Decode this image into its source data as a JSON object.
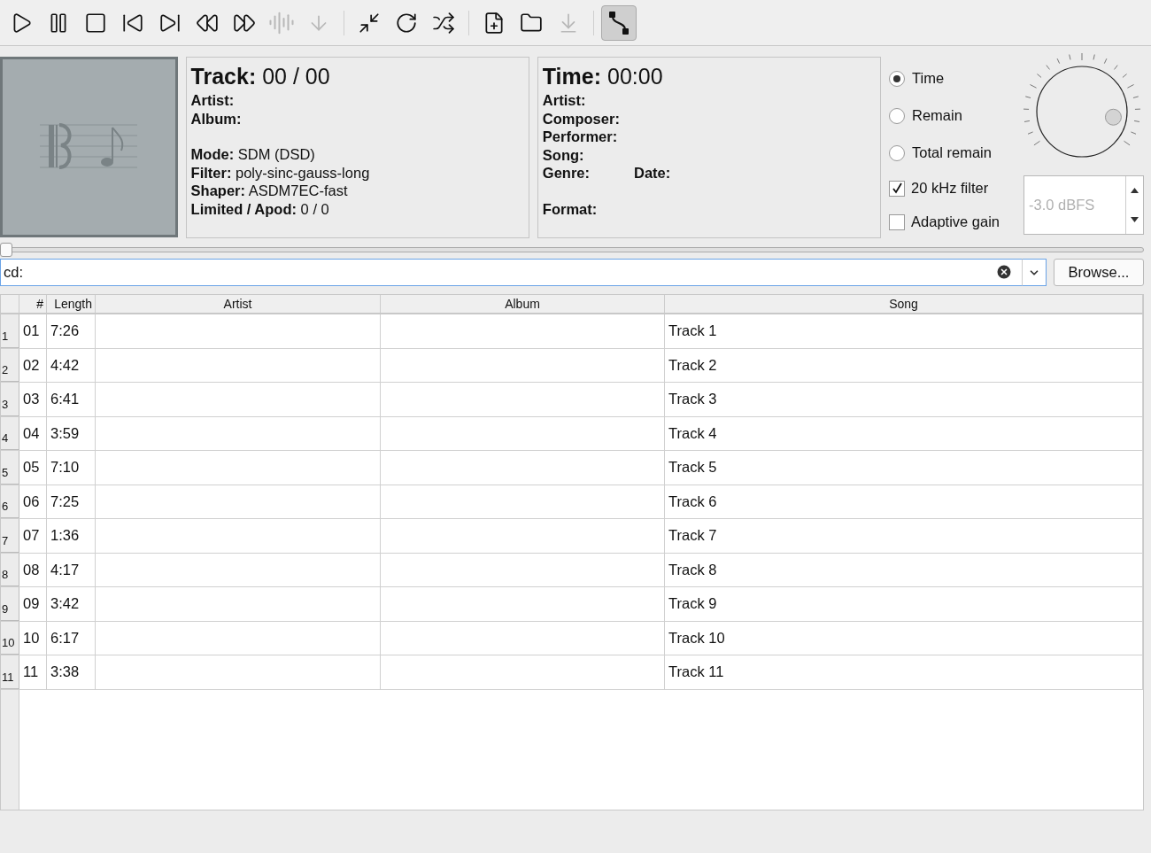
{
  "toolbar": {
    "groups": [
      [
        {
          "disabled": false,
          "selected": false
        },
        {
          "disabled": false,
          "selected": false
        },
        {
          "disabled": false,
          "selected": false
        },
        {
          "disabled": false,
          "selected": false
        },
        {
          "disabled": false,
          "selected": false
        },
        {
          "disabled": false,
          "selected": false
        },
        {
          "disabled": false,
          "selected": false
        },
        {
          "disabled": true,
          "selected": false
        },
        {
          "disabled": true,
          "selected": false
        }
      ],
      [
        {
          "disabled": false,
          "selected": false
        },
        {
          "disabled": false,
          "selected": false
        },
        {
          "disabled": false,
          "selected": false
        }
      ],
      [
        {
          "disabled": false,
          "selected": false
        },
        {
          "disabled": false,
          "selected": false
        },
        {
          "disabled": true,
          "selected": false
        }
      ],
      [
        {
          "disabled": false,
          "selected": true
        }
      ]
    ]
  },
  "track_panel": {
    "heading": {
      "label": "Track:",
      "value": "00 / 00"
    },
    "blocks": [
      [
        [
          {
            "label": "Artist:"
          }
        ],
        [
          {
            "label": "Album:"
          }
        ]
      ],
      [
        [
          {
            "label": "Mode:",
            "value": "SDM (DSD)"
          }
        ],
        [
          {
            "label": "Filter:",
            "value": "poly-sinc-gauss-long"
          }
        ],
        [
          {
            "label": "Shaper:",
            "value": "ASDM7EC-fast"
          }
        ],
        [
          {
            "label": "Limited / Apod:",
            "value": "0 / 0"
          }
        ]
      ]
    ]
  },
  "time_panel": {
    "heading": {
      "label": "Time:",
      "value": "00:00"
    },
    "blocks": [
      [
        [
          {
            "label": "Artist:"
          }
        ],
        [
          {
            "label": "Composer:"
          }
        ],
        [
          {
            "label": "Performer:"
          }
        ],
        [
          {
            "label": "Song:"
          }
        ],
        [
          {
            "label": "Genre:"
          },
          {
            "label": "Date:"
          }
        ]
      ],
      [
        [
          {
            "label": "Format:"
          }
        ]
      ]
    ]
  },
  "time_display": [
    {
      "label": "Time",
      "selected": true
    },
    {
      "label": "Remain",
      "selected": false
    },
    {
      "label": "Total remain",
      "selected": false
    }
  ],
  "options": [
    {
      "label": "20 kHz filter",
      "checked": true
    },
    {
      "label": "Adaptive gain",
      "checked": false
    }
  ],
  "volume_knob": {
    "level": 0.9
  },
  "gain_spinbox": {
    "value": "-3.0 dBFS",
    "disabled": true
  },
  "seek_slider": {
    "level": 0
  },
  "path_field": {
    "value": "cd:"
  },
  "browse_button": "Browse...",
  "table": {
    "columns": [
      "#",
      "Length",
      "Artist",
      "Album",
      "Song"
    ],
    "rows": [
      {
        "row_header": "1",
        "number": "01",
        "length": "7:26",
        "song": "Track 1"
      },
      {
        "row_header": "2",
        "number": "02",
        "length": "4:42",
        "song": "Track 2"
      },
      {
        "row_header": "3",
        "number": "03",
        "length": "6:41",
        "song": "Track 3"
      },
      {
        "row_header": "4",
        "number": "04",
        "length": "3:59",
        "song": "Track 4"
      },
      {
        "row_header": "5",
        "number": "05",
        "length": "7:10",
        "song": "Track 5"
      },
      {
        "row_header": "6",
        "number": "06",
        "length": "7:25",
        "song": "Track 6"
      },
      {
        "row_header": "7",
        "number": "07",
        "length": "1:36",
        "song": "Track 7"
      },
      {
        "row_header": "8",
        "number": "08",
        "length": "4:17",
        "song": "Track 8"
      },
      {
        "row_header": "9",
        "number": "09",
        "length": "3:42",
        "song": "Track 9"
      },
      {
        "row_header": "10",
        "number": "10",
        "length": "6:17",
        "song": "Track 10"
      },
      {
        "row_header": "11",
        "number": "11",
        "length": "3:38",
        "song": "Track 11"
      }
    ]
  }
}
